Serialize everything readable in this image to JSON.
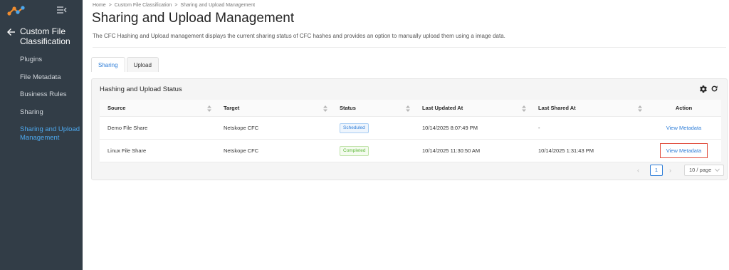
{
  "sidebar": {
    "back_title": "Custom File Classification",
    "items": [
      {
        "label": "Plugins",
        "active": false
      },
      {
        "label": "File Metadata",
        "active": false
      },
      {
        "label": "Business Rules",
        "active": false
      },
      {
        "label": "Sharing",
        "active": false
      },
      {
        "label": "Sharing and Upload Management",
        "active": true
      }
    ]
  },
  "breadcrumb": {
    "items": [
      "Home",
      "Custom File Classification",
      "Sharing and Upload Management"
    ],
    "separator": ">"
  },
  "page": {
    "title": "Sharing and Upload Management",
    "description": "The CFC Hashing and Upload management displays the current sharing status of CFC hashes and provides an option to manually upload them using a image data."
  },
  "tabs": [
    {
      "label": "Sharing",
      "active": true
    },
    {
      "label": "Upload",
      "active": false
    }
  ],
  "panel": {
    "title": "Hashing and Upload Status"
  },
  "table": {
    "columns": [
      "Source",
      "Target",
      "Status",
      "Last Updated At",
      "Last Shared At",
      "Action"
    ],
    "rows": [
      {
        "source": "Demo File Share",
        "target": "Netskope CFC",
        "status": "Scheduled",
        "last_updated": "10/14/2025 8:07:49 PM",
        "last_shared": "-",
        "action": "View Metadata"
      },
      {
        "source": "Linux File Share",
        "target": "Netskope CFC",
        "status": "Completed",
        "last_updated": "10/14/2025 11:30:50 AM",
        "last_shared": "10/14/2025 1:31:43 PM",
        "action": "View Metadata"
      }
    ]
  },
  "pagination": {
    "current_page": "1",
    "page_size": "10 / page",
    "prev_symbol": "‹",
    "next_symbol": "›"
  },
  "colors": {
    "sidebar_bg": "#323d47",
    "accent": "#2f7ed8",
    "active_nav": "#4da8ee",
    "highlight_box": "#e04a3a"
  }
}
